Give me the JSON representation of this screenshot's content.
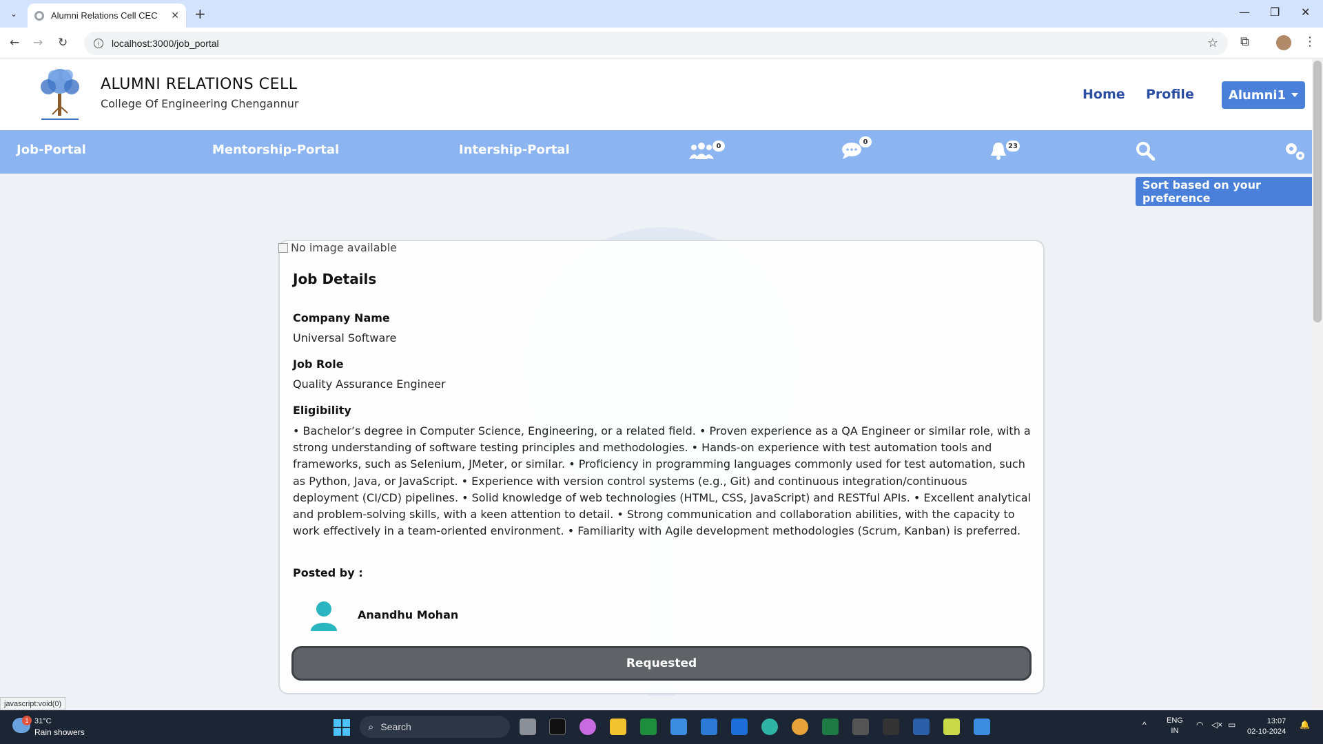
{
  "browser": {
    "tab_title": "Alumni Relations Cell CEC",
    "url": "localhost:3000/job_portal"
  },
  "header": {
    "title": "ALUMNI RELATIONS CELL",
    "subtitle": "College Of Engineering Chengannur",
    "links": {
      "home": "Home",
      "profile": "Profile"
    },
    "user_menu": "Alumni1"
  },
  "navbar": {
    "items": [
      "Job-Portal",
      "Mentorship-Portal",
      "Intership-Portal"
    ],
    "connections_count": "0",
    "messages_count": "0",
    "notifications_count": "23"
  },
  "sort_button": "Sort based on your preference",
  "job": {
    "image_alt": "No image available",
    "heading": "Job Details",
    "company_label": "Company Name",
    "company": "Universal Software",
    "role_label": "Job Role",
    "role": "Quality Assurance Engineer",
    "eligibility_label": "Eligibility",
    "eligibility": "• Bachelor’s degree in Computer Science, Engineering, or a related field. • Proven experience as a QA Engineer or similar role, with a strong understanding of software testing principles and methodologies. • Hands-on experience with test automation tools and frameworks, such as Selenium, JMeter, or similar. • Proficiency in programming languages commonly used for test automation, such as Python, Java, or JavaScript. • Experience with version control systems (e.g., Git) and continuous integration/continuous deployment (CI/CD) pipelines. • Solid knowledge of web technologies (HTML, CSS, JavaScript) and RESTful APIs. • Excellent analytical and problem-solving skills, with a keen attention to detail. • Strong communication and collaboration abilities, with the capacity to work effectively in a team-oriented environment. • Familiarity with Agile development methodologies (Scrum, Kanban) is preferred.",
    "posted_by_label": "Posted by :",
    "poster_name": "Anandhu Mohan",
    "action_button": "Requested"
  },
  "status_bar": "javascript:void(0)",
  "taskbar": {
    "weather_temp": "31°C",
    "weather_desc": "Rain showers",
    "weather_badge": "1",
    "search_placeholder": "Search",
    "lang": "ENG",
    "region": "IN",
    "time": "13:07",
    "date": "02-10-2024"
  },
  "colors": {
    "navbar": "#8bb4f0",
    "primary_button": "#4a80d9",
    "link": "#2d4fa3",
    "requested_button": "#5f6368"
  }
}
